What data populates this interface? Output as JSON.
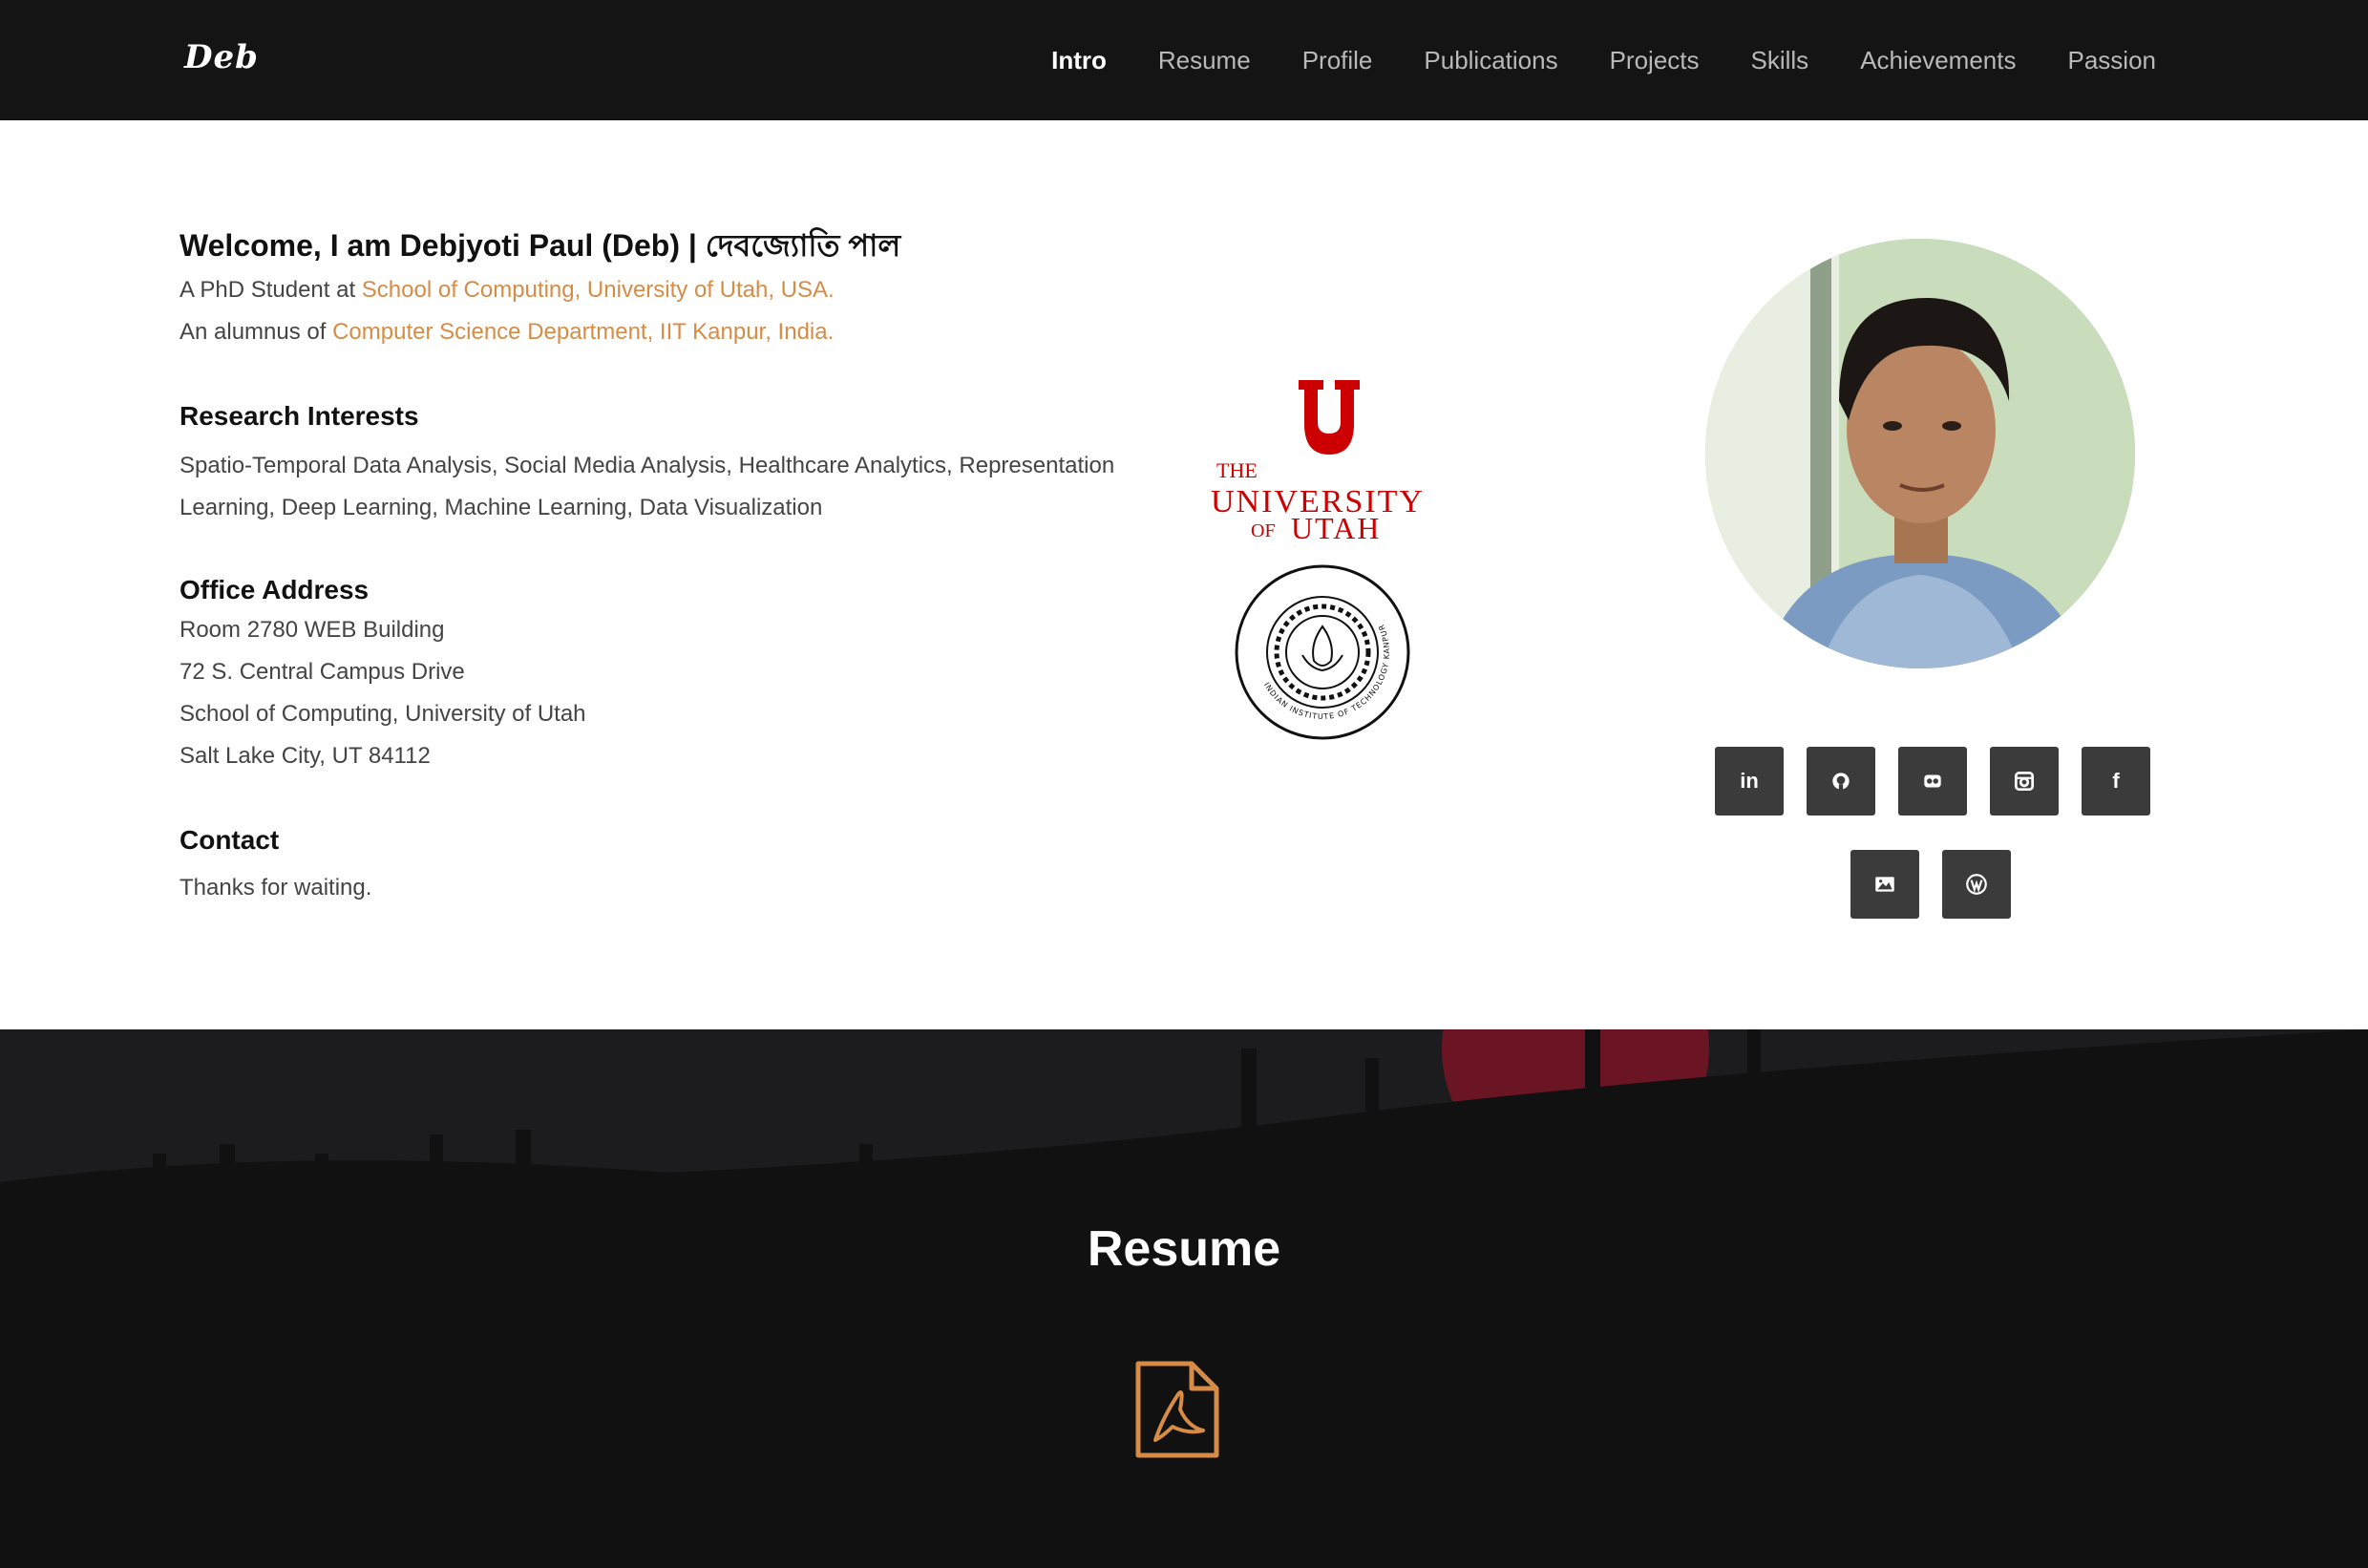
{
  "brand": "Deb",
  "nav": {
    "items": [
      {
        "label": "Intro",
        "active": true
      },
      {
        "label": "Resume",
        "active": false
      },
      {
        "label": "Profile",
        "active": false
      },
      {
        "label": "Publications",
        "active": false
      },
      {
        "label": "Projects",
        "active": false
      },
      {
        "label": "Skills",
        "active": false
      },
      {
        "label": "Achievements",
        "active": false
      },
      {
        "label": "Passion",
        "active": false
      }
    ]
  },
  "intro": {
    "welcome": "Welcome, I am Debjyoti Paul (Deb) | দেবজ্যোতি পাল",
    "phd_prefix": "A PhD Student at ",
    "phd_link": "School of Computing, University of Utah, USA.",
    "alum_prefix": "An alumnus of ",
    "alum_link": "Computer Science Department, IIT Kanpur, India.",
    "research_heading": "Research Interests",
    "research_line1": "Spatio-Temporal Data Analysis, Social Media Analysis, Healthcare Analytics, Representation",
    "research_line2": "Learning, Deep Learning, Machine Learning, Data Visualization",
    "office_heading": "Office Address",
    "office_lines": [
      "Room 2780 WEB Building",
      "72 S. Central Campus Drive",
      "School of Computing, University of Utah",
      "Salt Lake City, UT 84112"
    ],
    "contact_heading": "Contact",
    "contact_text": "Thanks for waiting."
  },
  "logos": {
    "utah": {
      "the": "THE",
      "university": "UNIVERSITY",
      "of": "OF",
      "utah": "UTAH",
      "color": "#cc0000"
    },
    "iitk": {
      "ring_text": "INDIAN INSTITUTE OF TECHNOLOGY KANPUR"
    }
  },
  "social": {
    "row1": [
      "linkedin-icon",
      "github-icon",
      "flickr-icon",
      "instagram-icon",
      "facebook-icon"
    ],
    "row2": [
      "gallery-icon",
      "wordpress-icon"
    ],
    "labels": {
      "linkedin": "in",
      "facebook": "f"
    }
  },
  "resume": {
    "title": "Resume",
    "accent": "#d68c45"
  }
}
